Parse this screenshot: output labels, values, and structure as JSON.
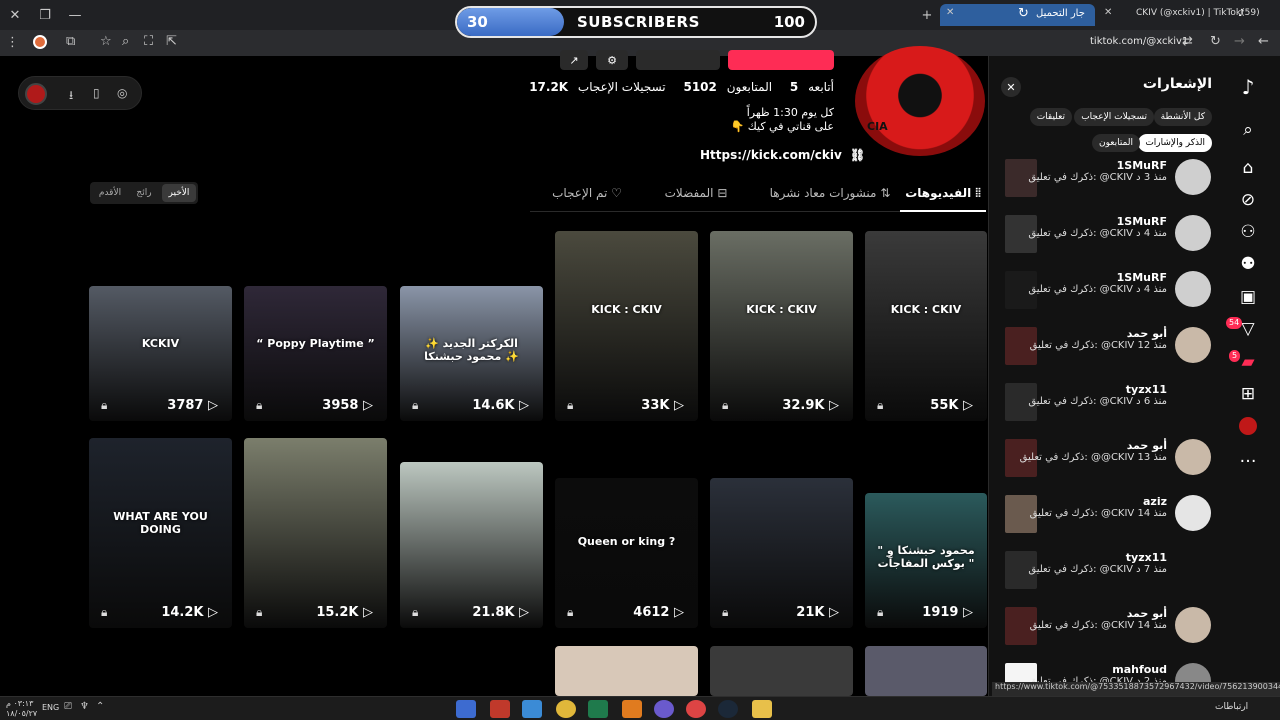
{
  "browser": {
    "tabs": [
      {
        "label": "جار التحميل",
        "active": true
      },
      {
        "label": "CKIV (@xckiv1) | TikTok(59)",
        "active": false
      }
    ],
    "url": "tiktok.com/@xckiv1",
    "status_url": "https://www.tiktok.com/@7533518873572967432/video/7562139003441466631"
  },
  "overlay": {
    "left_value": "30",
    "label": "SUBSCRIBERS",
    "right_value": "100",
    "progress": 0.3
  },
  "profile": {
    "following_label": "أتابعه",
    "following_value": "5",
    "followers_label": "المتابعون",
    "followers_value": "5102",
    "likes_label": "تسجيلات الإعجاب",
    "likes_value": "17.2K",
    "bio_line1": "كل يوم 1:30 ظهراً",
    "bio_line2": "على قناتي في كيك 👇",
    "link": "Https://kick.com/ckiv",
    "avatar_text": "CIA"
  },
  "tabs": [
    {
      "label": "الفيديوهات",
      "active": true
    },
    {
      "label": "منشورات معاد نشرها",
      "active": false
    },
    {
      "label": "المفضلات",
      "active": false
    },
    {
      "label": "تم الإعجاب",
      "active": false
    }
  ],
  "sort": [
    "الأخير",
    "رائج",
    "الأقدم"
  ],
  "videos": [
    {
      "views": "55K",
      "color": "#3a3a3a",
      "caption": "KICK : CKIV"
    },
    {
      "views": "32.9K",
      "color": "#6a6e64",
      "caption": "KICK : CKIV"
    },
    {
      "views": "33K",
      "color": "#4b4a3e",
      "caption": "KICK : CKIV"
    },
    {
      "views": "14.6K",
      "color": "#8a95a8",
      "caption": "الكركتر الجديد ✨ محمود حبشنكا ✨"
    },
    {
      "views": "3958",
      "color": "#2f2838",
      "caption": "“ Poppy Playtime ”"
    },
    {
      "views": "3787",
      "color": "#545a64",
      "caption": "KCKIV"
    },
    {
      "views": "1919",
      "color": "#2b5a5c",
      "caption": "محمود حبشنكا و \" بوكس المفاجآت \""
    },
    {
      "views": "21K",
      "color": "#2b303a",
      "caption": ""
    },
    {
      "views": "4612",
      "color": "#0c0c0c",
      "caption": "Queen or king ?"
    },
    {
      "views": "21.8K",
      "color": "#bcc7c0",
      "caption": ""
    },
    {
      "views": "15.2K",
      "color": "#7b7e6c",
      "caption": ""
    },
    {
      "views": "14.2K",
      "color": "#1e232c",
      "caption": "WHAT ARE YOU DOING"
    }
  ],
  "notifications": {
    "title": "الإشعارات",
    "filters": [
      "كل الأنشطة",
      "تسجيلات الإعجاب",
      "تعليقات",
      "المتابعون",
      "الذكر والإشارات"
    ],
    "items": [
      {
        "user": "1SMuRF",
        "text": "ذكرك في تعليق: @CKIV منذ 3 د",
        "avatar": "#cfcfcf",
        "thumb": "#3b2a2a"
      },
      {
        "user": "1SMuRF",
        "text": "ذكرك في تعليق: @CKIV منذ 4 د",
        "avatar": "#cfcfcf",
        "thumb": "#333"
      },
      {
        "user": "1SMuRF",
        "text": "ذكرك في تعليق: @CKIV منذ 4 د",
        "avatar": "#cfcfcf",
        "thumb": "#1a1a1a"
      },
      {
        "user": "أبو حمد",
        "text": "ذكرك في تعليق: @CKIV منذ 12",
        "avatar": "#c9b9a8",
        "thumb": "#4a2020"
      },
      {
        "user": "tyzx11",
        "text": "ذكرك في تعليق: @CKIV منذ 6 د",
        "avatar": "#121212",
        "thumb": "#2a2a2a"
      },
      {
        "user": "أبو حمد",
        "text": "ذكرك في تعليق: @@CKIV منذ 13",
        "avatar": "#c9b9a8",
        "thumb": "#4a2020"
      },
      {
        "user": "aziz",
        "text": "ذكرك في تعليق: @CKIV منذ 14",
        "avatar": "#e5e5e5",
        "thumb": "#6a5a4e"
      },
      {
        "user": "tyzx11",
        "text": "ذكرك في تعليق: @CKIV منذ 7 د",
        "avatar": "#121212",
        "thumb": "#2a2a2a"
      },
      {
        "user": "أبو حمد",
        "text": "ذكرك في تعليق: @CKIV منذ 14",
        "avatar": "#c9b9a8",
        "thumb": "#4a2020"
      },
      {
        "user": "mahfoud",
        "text": "ذكرك في تعليق: @CKIV منذ 2 د",
        "avatar": "#888",
        "thumb": "#f5f5f5"
      }
    ]
  },
  "rail": {
    "badge_inbox": "54",
    "badge_messages": "5"
  },
  "taskbar": {
    "lang": "ENG",
    "time": "٠٣:١٣ م",
    "date": "١٨/٠٥/٢٧",
    "region": "ارتباطات"
  },
  "colors": {
    "accent": "#fe2c55",
    "tab_active": "#2e5f9e",
    "overlay_fill": "#4a7ed8"
  }
}
